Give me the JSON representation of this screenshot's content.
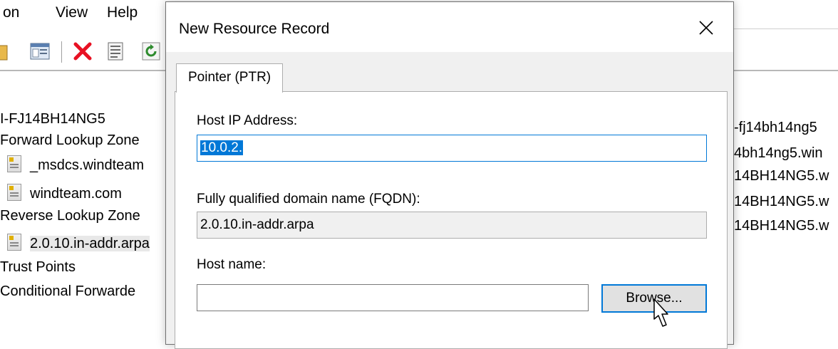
{
  "menubar": {
    "items": [
      "on",
      "View",
      "Help"
    ]
  },
  "toolbar": {
    "icons": [
      "folder-icon",
      "view-icon",
      "delete-icon",
      "properties-icon",
      "refresh-icon"
    ]
  },
  "tree": {
    "server": "I-FJ14BH14NG5",
    "forward_zones": "Forward Lookup Zone",
    "zone_msdcs": "_msdcs.windteam",
    "zone_windteam": "windteam.com",
    "reverse_zones": "Reverse Lookup Zone",
    "zone_reverse": "2.0.10.in-addr.arpa",
    "trust_points": "Trust Points",
    "conditional": "Conditional Forwarde"
  },
  "right_column": [
    "-fj14bh14ng5",
    "4bh14ng5.win",
    "14BH14NG5.w",
    "14BH14NG5.w",
    "14BH14NG5.w"
  ],
  "dialog": {
    "title": "New Resource Record",
    "tab": "Pointer (PTR)",
    "host_ip_label": "Host IP Address:",
    "host_ip_value": "10.0.2.",
    "fqdn_label": "Fully qualified domain name (FQDN):",
    "fqdn_value": "2.0.10.in-addr.arpa",
    "host_name_label": "Host name:",
    "host_name_value": "",
    "browse_label": "Browse..."
  },
  "colors": {
    "selection": "#0078d7",
    "dialog_bg": "#f0f0f0",
    "delete_red": "#e81123"
  }
}
